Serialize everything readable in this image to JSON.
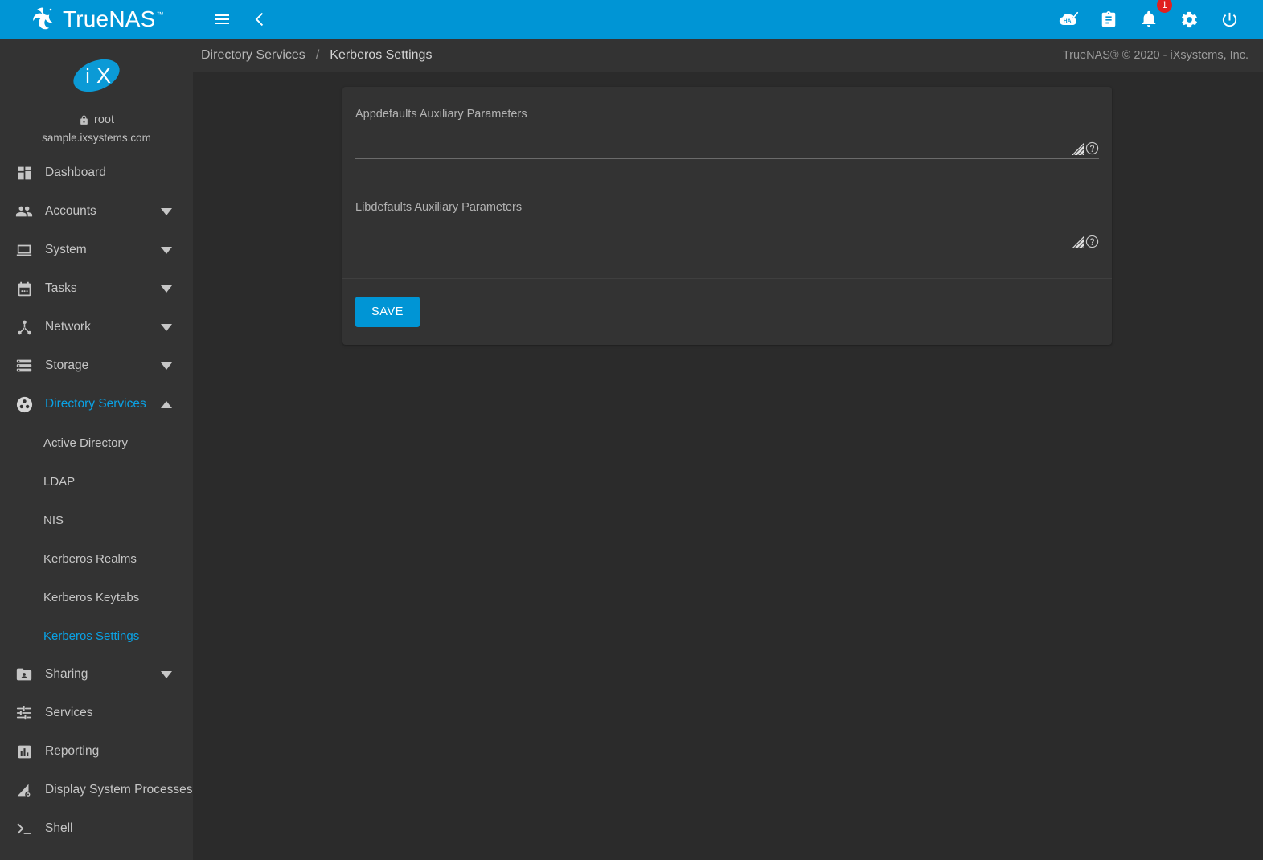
{
  "app": {
    "brand_name": "TrueNAS",
    "brand_tm": "™",
    "copyright": "TrueNAS® © 2020 - iXsystems, Inc."
  },
  "topbar": {
    "menu_icon": "hamburger-menu-icon",
    "back_icon": "chevron-left-icon",
    "icons": [
      {
        "name": "ha-status-icon",
        "label": "HA"
      },
      {
        "name": "task-manager-icon",
        "label": ""
      },
      {
        "name": "notifications-bell-icon",
        "label": ""
      },
      {
        "name": "settings-gear-icon",
        "label": ""
      },
      {
        "name": "power-icon",
        "label": ""
      }
    ],
    "notification_count": "1"
  },
  "sidebar": {
    "logo": "ix-systems-logo",
    "logo_text": "iX",
    "username": "root",
    "hostname": "sample.ixsystems.com",
    "lock_icon": "lock-icon",
    "items": [
      {
        "label": "Dashboard",
        "icon": "dashboard-icon",
        "expandable": false,
        "active": false
      },
      {
        "label": "Accounts",
        "icon": "accounts-icon",
        "expandable": true,
        "active": false
      },
      {
        "label": "System",
        "icon": "system-icon",
        "expandable": true,
        "active": false
      },
      {
        "label": "Tasks",
        "icon": "tasks-icon",
        "expandable": true,
        "active": false
      },
      {
        "label": "Network",
        "icon": "network-icon",
        "expandable": true,
        "active": false
      },
      {
        "label": "Storage",
        "icon": "storage-icon",
        "expandable": true,
        "active": false
      },
      {
        "label": "Directory Services",
        "icon": "directory-services-icon",
        "expandable": true,
        "active": true,
        "expanded": true
      }
    ],
    "directory_services_children": [
      {
        "label": "Active Directory",
        "active": false
      },
      {
        "label": "LDAP",
        "active": false
      },
      {
        "label": "NIS",
        "active": false
      },
      {
        "label": "Kerberos Realms",
        "active": false
      },
      {
        "label": "Kerberos Keytabs",
        "active": false
      },
      {
        "label": "Kerberos Settings",
        "active": true
      }
    ],
    "items_after": [
      {
        "label": "Sharing",
        "icon": "sharing-icon",
        "expandable": true,
        "active": false
      },
      {
        "label": "Services",
        "icon": "services-icon",
        "expandable": false,
        "active": false
      },
      {
        "label": "Reporting",
        "icon": "reporting-icon",
        "expandable": false,
        "active": false
      },
      {
        "label": "Display System Processes",
        "icon": "processes-icon",
        "expandable": false,
        "active": false
      },
      {
        "label": "Shell",
        "icon": "shell-icon",
        "expandable": false,
        "active": false
      }
    ]
  },
  "breadcrumb": {
    "parent": "Directory Services",
    "separator": "/",
    "current": "Kerberos Settings"
  },
  "form": {
    "fields": [
      {
        "label": "Appdefaults Auxiliary Parameters",
        "value": "",
        "placeholder": "",
        "help_icon": "help-circle-icon",
        "resize_icon": "resize-handle-icon"
      },
      {
        "label": "Libdefaults Auxiliary Parameters",
        "value": "",
        "placeholder": "",
        "help_icon": "help-circle-icon",
        "resize_icon": "resize-handle-icon"
      }
    ],
    "save_label": "SAVE"
  },
  "colors": {
    "accent": "#0095d5",
    "accent_link": "#0aa2e5",
    "sidebar_bg": "#333333",
    "page_bg": "#2b2b2b",
    "badge": "#e02020"
  }
}
